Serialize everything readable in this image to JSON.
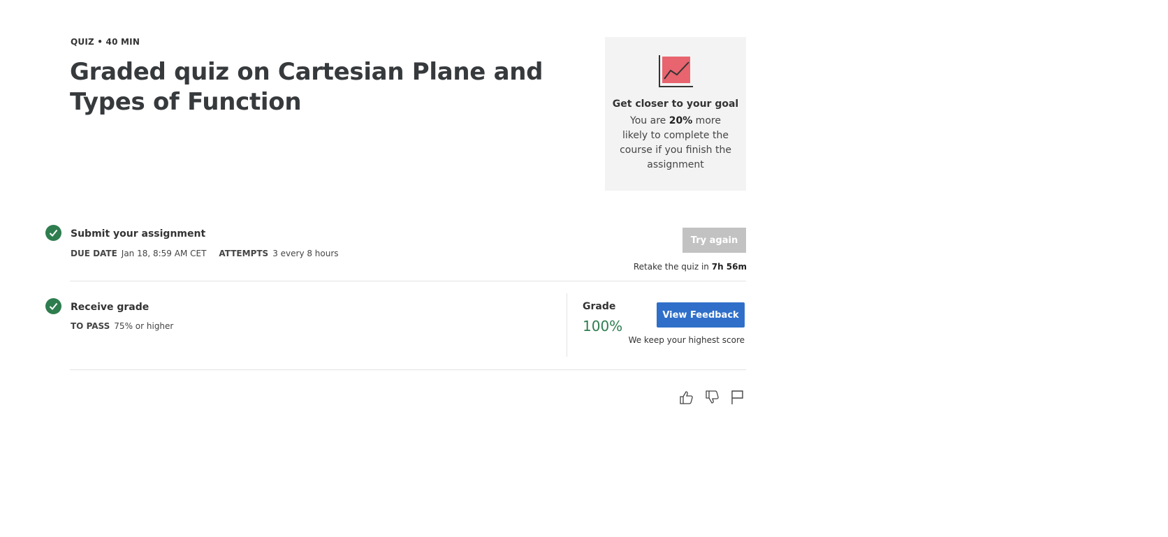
{
  "header": {
    "meta": "QUIZ • 40 MIN",
    "title": "Graded quiz on Cartesian Plane and Types of Function"
  },
  "goal_card": {
    "icon": "trend-chart-icon",
    "title": "Get closer to your goal",
    "text_before": "You are ",
    "percent": "20%",
    "text_after": " more likely to complete the course if you finish the assignment"
  },
  "submit_step": {
    "title": "Submit your assignment",
    "due_label": "DUE DATE",
    "due_value": "Jan 18, 8:59 AM CET",
    "attempts_label": "ATTEMPTS",
    "attempts_value": "3 every 8 hours",
    "try_again_label": "Try again",
    "retake_prefix": "Retake the quiz in ",
    "retake_time": "7h 56m"
  },
  "grade_step": {
    "title": "Receive grade",
    "to_pass_label": "TO PASS",
    "to_pass_value": "75% or higher",
    "grade_label": "Grade",
    "grade_value": "100%",
    "view_feedback_label": "View Feedback",
    "highest_note": "We keep your highest score"
  },
  "feedback_actions": {
    "icons": [
      "thumbs-up-icon",
      "thumbs-down-icon",
      "flag-icon"
    ]
  },
  "colors": {
    "success": "#2e7d4f",
    "primary": "#2f6fc9",
    "disabled": "#c2c2c2",
    "card_bg": "#f3f3f3",
    "chart_accent": "#e8646e"
  }
}
